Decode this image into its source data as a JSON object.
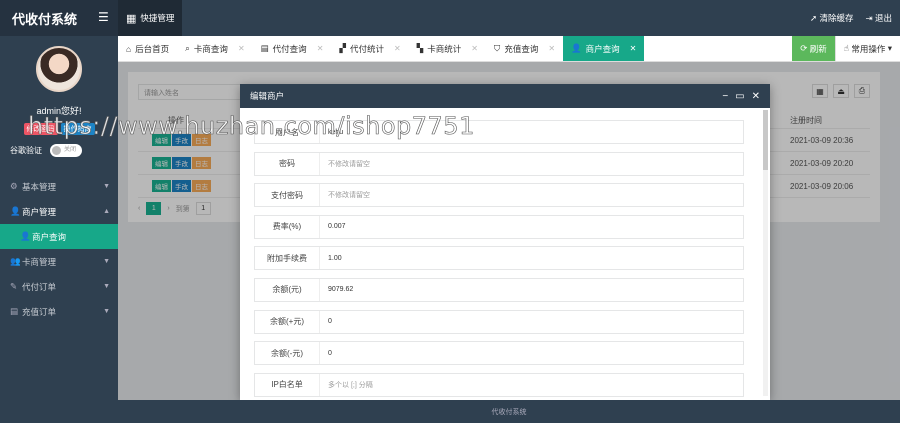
{
  "app": {
    "title": "代收付系统"
  },
  "topbar": {
    "quick_label": "快捷管理",
    "clear_cache": "清除缓存",
    "logout": "退出"
  },
  "profile": {
    "greeting": "admin您好!",
    "tag_bind": "修改密码",
    "tag_guide": "操作指南",
    "gauth_label": "谷歌验证",
    "gauth_state": "关闭"
  },
  "sidebar": {
    "items": [
      {
        "label": "基本管理",
        "icon": "gear-icon"
      },
      {
        "label": "商户管理",
        "icon": "user-icon"
      },
      {
        "label": "商户查询",
        "icon": "user-icon"
      },
      {
        "label": "卡商管理",
        "icon": "users-icon"
      },
      {
        "label": "代付订单",
        "icon": "edit-icon"
      },
      {
        "label": "充值订单",
        "icon": "file-icon"
      }
    ]
  },
  "tabs": [
    {
      "label": "后台首页"
    },
    {
      "label": "卡商查询"
    },
    {
      "label": "代付查询"
    },
    {
      "label": "代付统计"
    },
    {
      "label": "卡商统计"
    },
    {
      "label": "充值查询"
    },
    {
      "label": "商户查询"
    }
  ],
  "tab_actions": {
    "refresh": "刷新",
    "ops": "常用操作"
  },
  "list": {
    "search_placeholder": "请输入姓名",
    "col_ops": "操作",
    "col_time": "注册时间",
    "btn_edit": "编辑",
    "btn_hand": "手改",
    "btn_log": "日志",
    "rows": [
      {
        "time": "2021-03-09 20:36"
      },
      {
        "time": "2021-03-09 20:20"
      },
      {
        "time": "2021-03-09 20:06"
      }
    ],
    "page": "1",
    "goto_label": "到第",
    "goto_value": "1"
  },
  "modal": {
    "title": "编辑商户",
    "fields": [
      {
        "label": "用户名",
        "value": "kehu"
      },
      {
        "label": "密码",
        "value": "不修改请留空",
        "placeholder": true
      },
      {
        "label": "支付密码",
        "value": "不修改请留空",
        "placeholder": true
      },
      {
        "label": "费率(%)",
        "value": "0.007"
      },
      {
        "label": "附加手续费",
        "value": "1.00"
      },
      {
        "label": "余额(元)",
        "value": "9079.62"
      },
      {
        "label": "余额(+元)",
        "value": "0"
      },
      {
        "label": "余额(-元)",
        "value": "0"
      },
      {
        "label": "IP白名单",
        "value": "多个以 [;] 分隔",
        "placeholder": true
      }
    ]
  },
  "footer": {
    "text": "代收付系统"
  },
  "watermark": {
    "text": "https://www.huzhan.com/ishop7751"
  }
}
